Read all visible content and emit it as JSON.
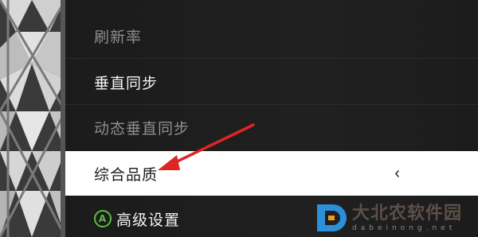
{
  "menu": {
    "items": [
      {
        "label": "刷新率",
        "state": "dim"
      },
      {
        "label": "垂直同步",
        "state": "normal"
      },
      {
        "label": "动态垂直同步",
        "state": "dim"
      },
      {
        "label": "综合品质",
        "state": "selected",
        "indicator": "‹"
      },
      {
        "label": "高级设置",
        "state": "normal",
        "button_glyph": "A"
      }
    ]
  },
  "annotation": {
    "arrow_color": "#e02424"
  },
  "watermark": {
    "brand": "大北农软件园",
    "url": "dabeinong.net",
    "logo_color": "#2b8fd9"
  }
}
